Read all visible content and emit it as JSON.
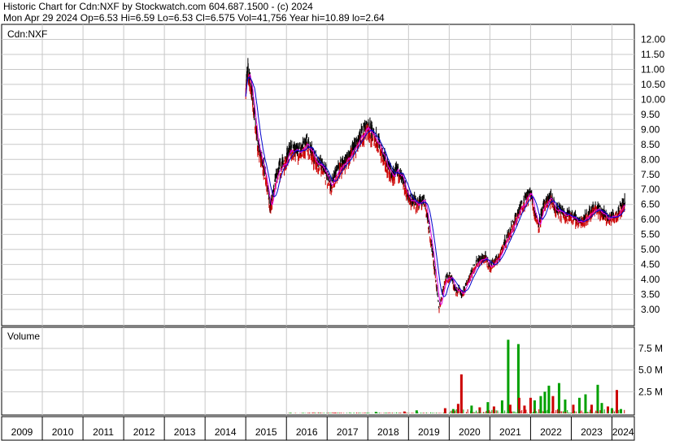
{
  "header": {
    "line1": "Historic Chart for Cdn:NXF by Stockwatch.com 604.687.1500 - (c) 2024",
    "line2": "Mon Apr 29 2024  Op=6.53  Hi=6.59  Lo=6.53  Cl=6.575  Vol=41,756  Year hi=10.89  lo=2.64"
  },
  "chart_data": [
    {
      "type": "line",
      "title": "Cdn:NXF",
      "ylim": [
        2.6,
        12.3
      ],
      "y_ticks": [
        "12.00",
        "11.50",
        "11.00",
        "10.50",
        "10.00",
        "9.50",
        "9.00",
        "8.50",
        "8.00",
        "7.50",
        "7.00",
        "6.50",
        "6.00",
        "5.50",
        "5.00",
        "4.50",
        "4.00",
        "3.50",
        "3.00"
      ],
      "grid": true,
      "x": [
        2015.0,
        2015.05,
        2015.1,
        2015.15,
        2015.2,
        2015.3,
        2015.4,
        2015.5,
        2015.6,
        2015.75,
        2015.9,
        2016.0,
        2016.1,
        2016.3,
        2016.5,
        2016.7,
        2016.9,
        2017.1,
        2017.3,
        2017.5,
        2017.75,
        2017.9,
        2018.0,
        2018.1,
        2018.2,
        2018.4,
        2018.6,
        2018.75,
        2018.9,
        2019.0,
        2019.2,
        2019.4,
        2019.6,
        2019.75,
        2019.9,
        2020.05,
        2020.12,
        2020.2,
        2020.25,
        2020.3,
        2020.5,
        2020.7,
        2020.9,
        2021.0,
        2021.2,
        2021.4,
        2021.6,
        2021.8,
        2022.0,
        2022.1,
        2022.2,
        2022.35,
        2022.5,
        2022.6,
        2022.8,
        2023.0,
        2023.2,
        2023.4,
        2023.6,
        2023.75,
        2023.9,
        2024.0,
        2024.15,
        2024.32
      ],
      "series": [
        {
          "color": "#cc0000",
          "values": [
            10.4,
            10.9,
            10.7,
            10.2,
            9.6,
            8.4,
            7.9,
            7.4,
            6.3,
            7.4,
            7.8,
            8.0,
            8.3,
            8.2,
            8.5,
            8.0,
            7.7,
            7.1,
            7.7,
            8.0,
            8.5,
            8.9,
            9.1,
            8.8,
            8.7,
            8.0,
            7.4,
            7.6,
            7.1,
            6.7,
            6.5,
            6.6,
            4.8,
            3.0,
            4.0,
            4.1,
            3.7,
            3.6,
            3.7,
            3.4,
            4.1,
            4.6,
            4.7,
            4.4,
            4.7,
            5.3,
            5.9,
            6.5,
            6.9,
            6.2,
            5.8,
            6.5,
            6.7,
            6.3,
            6.2,
            6.1,
            5.9,
            6.1,
            6.4,
            6.2,
            6.0,
            6.1,
            6.2,
            6.575
          ]
        }
      ]
    },
    {
      "type": "bar",
      "title": "Volume",
      "y_ticks": [
        "7.5 M",
        "5.0 M",
        "2.5 M"
      ],
      "x_ticks": [
        "2009",
        "2010",
        "2011",
        "2012",
        "2013",
        "2014",
        "2015",
        "2016",
        "2017",
        "2018",
        "2019",
        "2020",
        "2021",
        "2022",
        "2023",
        "2024"
      ],
      "bars": [
        {
          "x": 2016.1,
          "value": 0.06,
          "color": "#00a000"
        },
        {
          "x": 2017.2,
          "value": 0.05,
          "color": "#cc0000"
        },
        {
          "x": 2018.2,
          "value": 0.18,
          "color": "#00a000"
        },
        {
          "x": 2018.9,
          "value": 0.22,
          "color": "#cc0000"
        },
        {
          "x": 2019.2,
          "value": 0.35,
          "color": "#00a000"
        },
        {
          "x": 2019.9,
          "value": 0.6,
          "color": "#cc0000"
        },
        {
          "x": 2020.1,
          "value": 0.5,
          "color": "#00a000"
        },
        {
          "x": 2020.22,
          "value": 1.1,
          "color": "#cc0000"
        },
        {
          "x": 2020.3,
          "value": 4.5,
          "color": "#cc0000"
        },
        {
          "x": 2020.55,
          "value": 0.9,
          "color": "#00a000"
        },
        {
          "x": 2020.75,
          "value": 0.7,
          "color": "#cc0000"
        },
        {
          "x": 2020.95,
          "value": 1.3,
          "color": "#00a000"
        },
        {
          "x": 2021.1,
          "value": 0.8,
          "color": "#cc0000"
        },
        {
          "x": 2021.3,
          "value": 1.5,
          "color": "#00a000"
        },
        {
          "x": 2021.45,
          "value": 8.5,
          "color": "#00a000"
        },
        {
          "x": 2021.5,
          "value": 1.0,
          "color": "#cc0000"
        },
        {
          "x": 2021.7,
          "value": 8.0,
          "color": "#00a000"
        },
        {
          "x": 2021.72,
          "value": 1.8,
          "color": "#cc0000"
        },
        {
          "x": 2021.85,
          "value": 0.9,
          "color": "#cc0000"
        },
        {
          "x": 2022.0,
          "value": 1.8,
          "color": "#cc0000"
        },
        {
          "x": 2022.1,
          "value": 1.5,
          "color": "#00a000"
        },
        {
          "x": 2022.25,
          "value": 2.0,
          "color": "#00a000"
        },
        {
          "x": 2022.35,
          "value": 2.5,
          "color": "#00a000"
        },
        {
          "x": 2022.45,
          "value": 3.2,
          "color": "#00a000"
        },
        {
          "x": 2022.55,
          "value": 2.0,
          "color": "#cc0000"
        },
        {
          "x": 2022.7,
          "value": 3.5,
          "color": "#00a000"
        },
        {
          "x": 2022.85,
          "value": 1.6,
          "color": "#00a000"
        },
        {
          "x": 2023.05,
          "value": 1.0,
          "color": "#cc0000"
        },
        {
          "x": 2023.2,
          "value": 1.8,
          "color": "#00a000"
        },
        {
          "x": 2023.35,
          "value": 2.2,
          "color": "#00a000"
        },
        {
          "x": 2023.5,
          "value": 1.0,
          "color": "#cc0000"
        },
        {
          "x": 2023.65,
          "value": 3.3,
          "color": "#00a000"
        },
        {
          "x": 2023.75,
          "value": 1.2,
          "color": "#00a000"
        },
        {
          "x": 2023.9,
          "value": 0.8,
          "color": "#cc0000"
        },
        {
          "x": 2024.0,
          "value": 0.6,
          "color": "#00a000"
        },
        {
          "x": 2024.12,
          "value": 2.7,
          "color": "#cc0000"
        },
        {
          "x": 2024.22,
          "value": 0.5,
          "color": "#00a000"
        }
      ]
    }
  ]
}
